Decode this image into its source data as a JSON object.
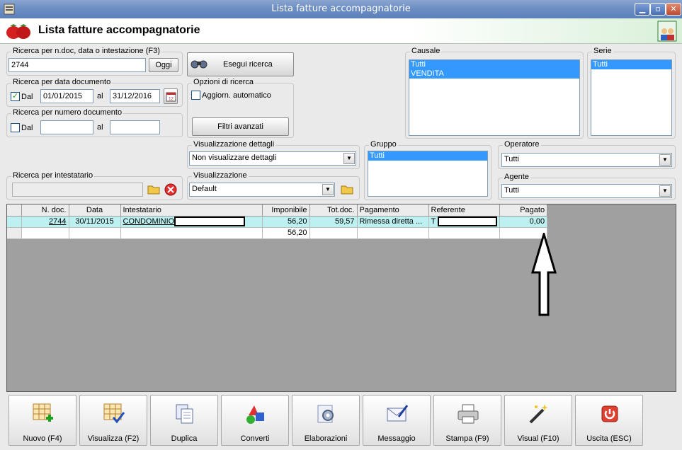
{
  "window": {
    "title": "Lista fatture accompagnatorie"
  },
  "header": {
    "title": "Lista fatture accompagnatorie"
  },
  "search_main": {
    "label": "Ricerca per n.doc, data o intestazione (F3)",
    "value": "2744",
    "today_label": "Oggi"
  },
  "run_search": {
    "label": "Esegui ricerca"
  },
  "date_search": {
    "label": "Ricerca per data documento",
    "dal_label": "Dal",
    "dal_checked": true,
    "from": "01/01/2015",
    "al_label": "al",
    "to": "31/12/2016"
  },
  "search_options": {
    "label": "Opzioni di ricerca",
    "auto_update_label": "Aggiorn. automatico"
  },
  "number_search": {
    "label": "Ricerca per numero documento",
    "dal_label": "Dal",
    "dal_checked": false,
    "from": "",
    "al_label": "al",
    "to": ""
  },
  "advanced_filters": {
    "label": "Filtri avanzati"
  },
  "causale": {
    "label": "Causale",
    "items": [
      "Tutti",
      "VENDITA"
    ]
  },
  "serie": {
    "label": "Serie",
    "items": [
      "Tutti"
    ]
  },
  "details_view": {
    "label": "Visualizzazione dettagli",
    "selected": "Non visualizzare dettagli"
  },
  "gruppo": {
    "label": "Gruppo",
    "items": [
      "Tutti"
    ]
  },
  "operatore": {
    "label": "Operatore",
    "selected": "Tutti"
  },
  "holder_search": {
    "label": "Ricerca per intestatario",
    "value": ""
  },
  "view": {
    "label": "Visualizzazione",
    "selected": "Default"
  },
  "agente": {
    "label": "Agente",
    "selected": "Tutti"
  },
  "grid": {
    "columns": [
      "N. doc.",
      "Data",
      "Intestatario",
      "Imponibile",
      "Tot.doc.",
      "Pagamento",
      "Referente",
      "Pagato"
    ],
    "rows": [
      {
        "ndoc": "2744",
        "data": "30/11/2015",
        "intestatario": "CONDOMINIO",
        "imponibile": "56,20",
        "totdoc": "59,57",
        "pagamento": "Rimessa diretta ...",
        "referente": "T",
        "pagato": "0,00"
      }
    ],
    "totals": {
      "imponibile": "56,20"
    }
  },
  "toolbar": [
    {
      "name": "nuovo-button",
      "label": "Nuovo (F4)"
    },
    {
      "name": "visualizza-button",
      "label": "Visualizza (F2)"
    },
    {
      "name": "duplica-button",
      "label": "Duplica"
    },
    {
      "name": "converti-button",
      "label": "Converti"
    },
    {
      "name": "elaborazioni-button",
      "label": "Elaborazioni"
    },
    {
      "name": "messaggio-button",
      "label": "Messaggio"
    },
    {
      "name": "stampa-button",
      "label": "Stampa (F9)"
    },
    {
      "name": "visual-button",
      "label": "Visual (F10)"
    },
    {
      "name": "uscita-button",
      "label": "Uscita (ESC)"
    }
  ],
  "colors": {
    "selection": "#3399ff",
    "row_highlight": "#bdf1f1",
    "grid_background": "#a0a0a0"
  }
}
